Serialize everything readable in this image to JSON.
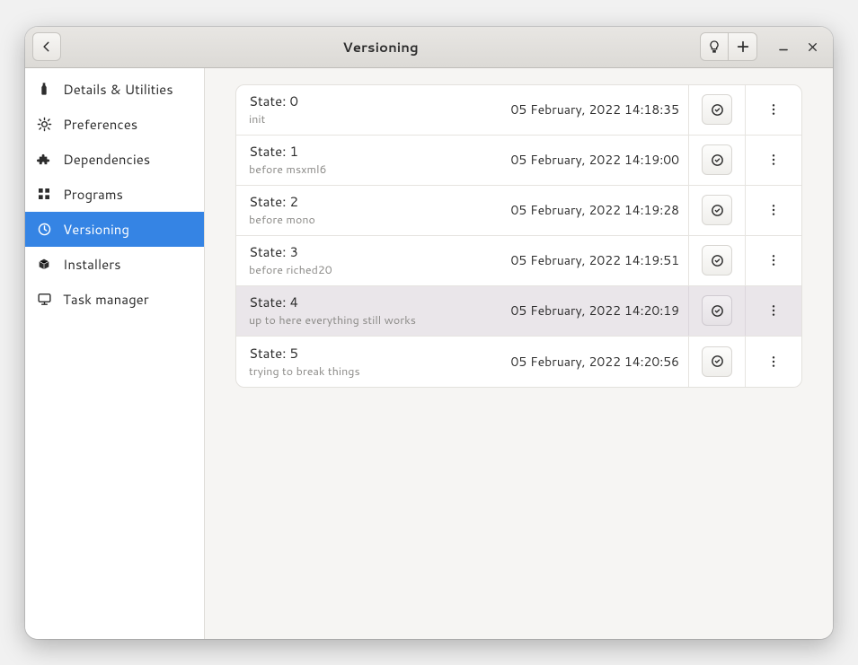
{
  "header": {
    "title": "Versioning"
  },
  "sidebar": {
    "items": [
      {
        "id": "details",
        "label": "Details & Utilities",
        "icon": "bottle",
        "active": false
      },
      {
        "id": "prefs",
        "label": "Preferences",
        "icon": "gear",
        "active": false
      },
      {
        "id": "deps",
        "label": "Dependencies",
        "icon": "puzzle",
        "active": false
      },
      {
        "id": "programs",
        "label": "Programs",
        "icon": "grid",
        "active": false
      },
      {
        "id": "versioning",
        "label": "Versioning",
        "icon": "clock",
        "active": true
      },
      {
        "id": "installers",
        "label": "Installers",
        "icon": "package",
        "active": false
      },
      {
        "id": "taskmgr",
        "label": "Task manager",
        "icon": "monitor",
        "active": false
      }
    ]
  },
  "states": [
    {
      "title": "State: 0",
      "subtitle": "init",
      "timestamp": "05 February, 2022 14:18:35",
      "highlight": false
    },
    {
      "title": "State: 1",
      "subtitle": "before msxml6",
      "timestamp": "05 February, 2022 14:19:00",
      "highlight": false
    },
    {
      "title": "State: 2",
      "subtitle": "before mono",
      "timestamp": "05 February, 2022 14:19:28",
      "highlight": false
    },
    {
      "title": "State: 3",
      "subtitle": "before riched20",
      "timestamp": "05 February, 2022 14:19:51",
      "highlight": false
    },
    {
      "title": "State: 4",
      "subtitle": "up to here everything still works",
      "timestamp": "05 February, 2022 14:20:19",
      "highlight": true
    },
    {
      "title": "State: 5",
      "subtitle": "trying to break things",
      "timestamp": "05 February, 2022 14:20:56",
      "highlight": false
    }
  ]
}
